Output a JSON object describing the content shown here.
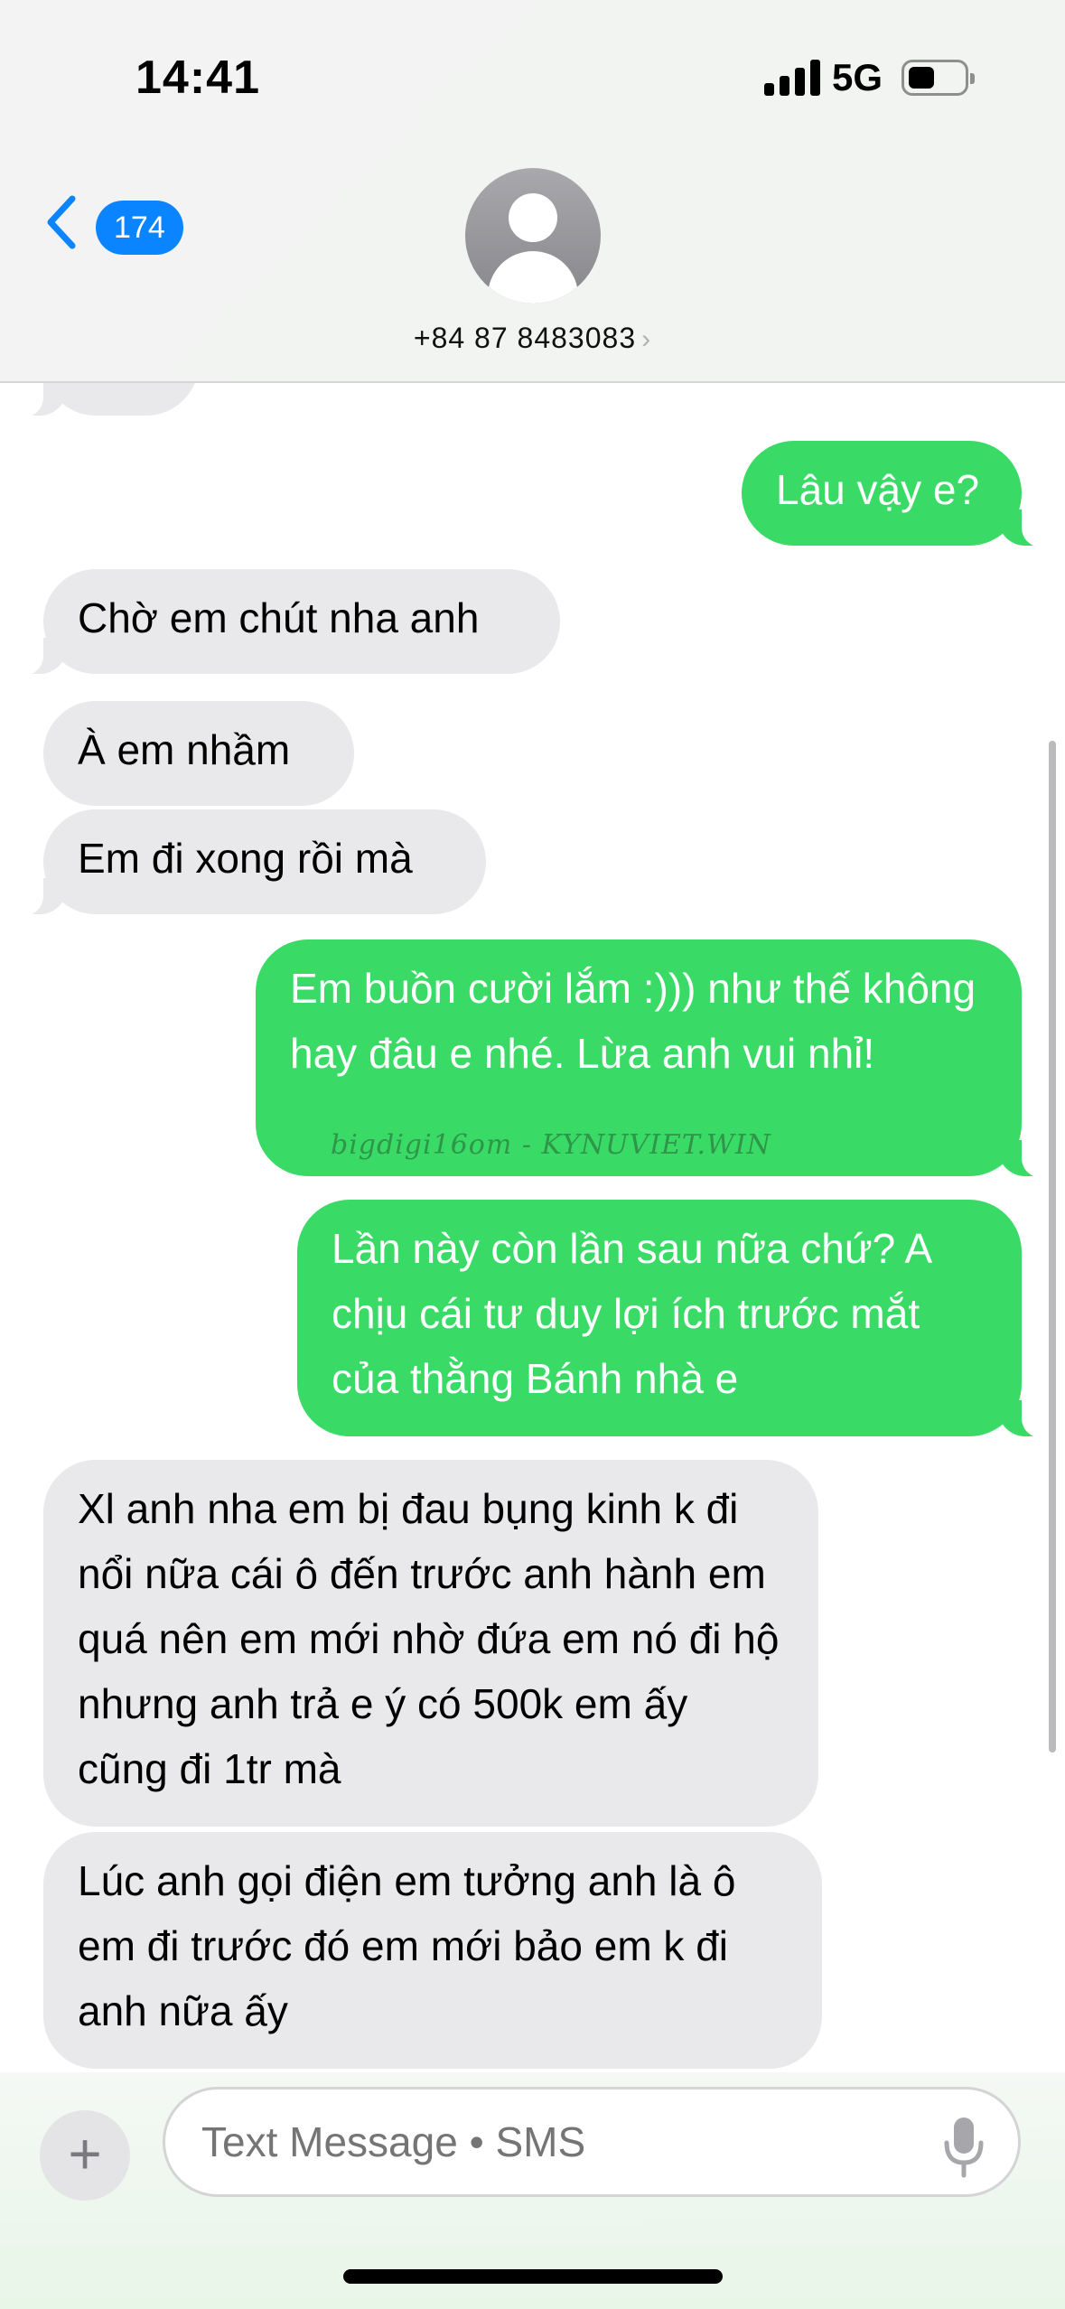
{
  "status_bar": {
    "time": "14:41",
    "network": "5G"
  },
  "nav": {
    "back_badge": "174",
    "contact": "+84 87 8483083"
  },
  "messages": [
    {
      "from": "in",
      "text": ""
    },
    {
      "from": "out",
      "text": "Lâu vậy e?"
    },
    {
      "from": "in",
      "text": "Chờ em chút nha anh"
    },
    {
      "from": "in",
      "text": "À em nhầm"
    },
    {
      "from": "in",
      "text": "Em đi xong rồi mà"
    },
    {
      "from": "out",
      "text": "Em buồn cười lắm :))) như thế không hay đâu e nhé. Lừa anh vui nhỉ!"
    },
    {
      "from": "out",
      "text": "Lần này còn lần sau nữa chứ? A chịu cái tư duy lợi ích trước mắt của thằng Bánh nhà e"
    },
    {
      "from": "in",
      "text": "Xl anh nha em bị đau bụng kinh k đi nổi nữa cái ô đến trước anh hành em quá nên em mới nhờ đứa em nó đi hộ nhưng anh trả e ý có 500k em ấy cũng đi 1tr mà"
    },
    {
      "from": "in",
      "text": "Lúc anh gọi điện em tưởng anh là ô em đi trước đó em mới bảo em k đi anh nữa ấy"
    }
  ],
  "watermark": "bigdigi16om - KYNUVIET.WIN",
  "composer": {
    "placeholder": "Text Message • SMS"
  }
}
